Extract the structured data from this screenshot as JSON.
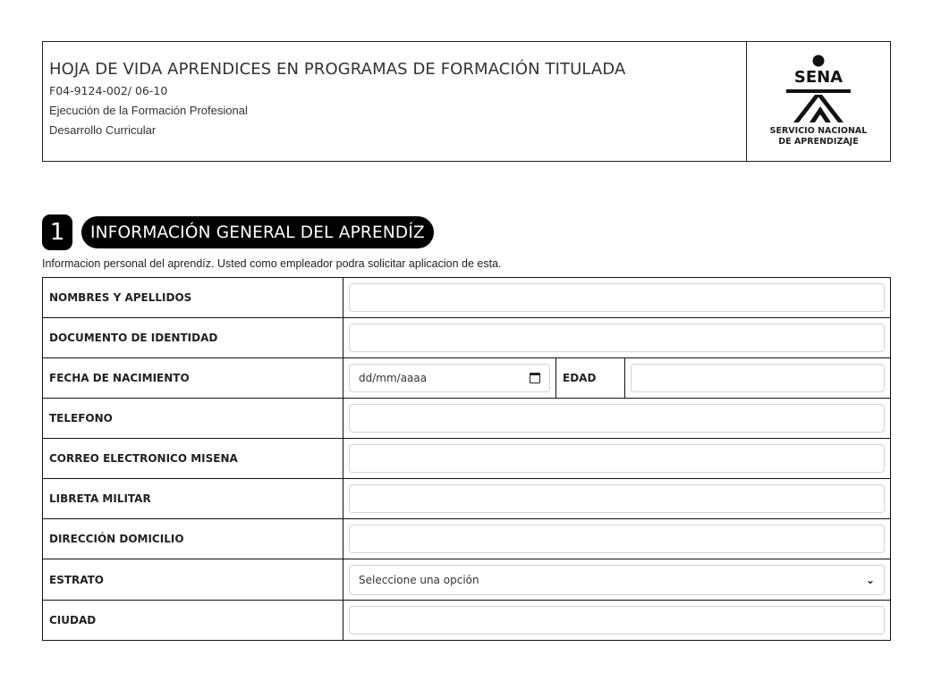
{
  "header": {
    "title": "HOJA DE VIDA APRENDICES EN PROGRAMAS DE FORMACIÓN TITULADA",
    "code": "F04-9124-002/ 06-10",
    "line1": "Ejecución de la Formación Profesional",
    "line2": "Desarrollo Curricular",
    "logo": {
      "wordmark": "SENA",
      "caption_line1": "SERVICIO NACIONAL",
      "caption_line2": "DE APRENDIZAJE",
      "icon": "sena-logo-icon"
    }
  },
  "section": {
    "number": "1",
    "title": "INFORMACIÓN GENERAL DEL APRENDÍZ",
    "description": "Informacion personal del aprendíz. Usted como empleador podra solicitar aplicacion de esta."
  },
  "form": {
    "nombres_label": "NOMBRES Y APELLIDOS",
    "nombres_value": "",
    "documento_label": "DOCUMENTO DE IDENTIDAD",
    "documento_value": "",
    "fecha_label": "FECHA DE NACIMIENTO",
    "fecha_placeholder": "dd/mm/aaaa",
    "edad_label": "EDAD",
    "edad_value": "",
    "telefono_label": "TELEFONO",
    "telefono_value": "",
    "correo_label": "CORREO ELECTRONICO MISENA",
    "correo_value": "",
    "libreta_label": "LIBRETA MILITAR",
    "libreta_value": "",
    "direccion_label": "DIRECCIÓN DOMICILIO",
    "direccion_value": "",
    "estrato_label": "ESTRATO",
    "estrato_selected": "Seleccione una opción",
    "ciudad_label": "CIUDAD",
    "ciudad_value": ""
  },
  "colors": {
    "accent": "#000000",
    "border": "#111111",
    "input_border": "#d4d4d4"
  }
}
